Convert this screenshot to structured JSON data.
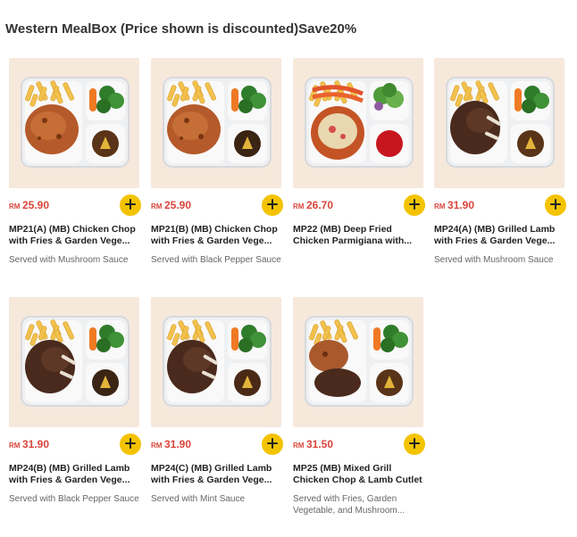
{
  "section": {
    "title": "Western MealBox (Price shown is discounted)Save20%"
  },
  "colors": {
    "accent": "#f4c300",
    "price": "#d9453b",
    "thumb_bg": "#f7e8dc"
  },
  "products": [
    {
      "currency": "RM",
      "price": "25.90",
      "name": "MP21(A) (MB) Chicken Chop with Fries & Garden Vege...",
      "desc": "Served with Mushroom Sauce",
      "meat": "chicken",
      "sauce": "mushroom"
    },
    {
      "currency": "RM",
      "price": "25.90",
      "name": "MP21(B) (MB) Chicken Chop with Fries & Garden Vege...",
      "desc": "Served with Black Pepper Sauce",
      "meat": "chicken",
      "sauce": "pepper"
    },
    {
      "currency": "RM",
      "price": "26.70",
      "name": "MP22 (MB) Deep Fried Chicken Parmigiana with...",
      "desc": "",
      "meat": "parmigiana",
      "sauce": "tomato"
    },
    {
      "currency": "RM",
      "price": "31.90",
      "name": "MP24(A) (MB) Grilled Lamb with Fries & Garden Vege...",
      "desc": "Served with Mushroom Sauce",
      "meat": "lamb",
      "sauce": "mushroom"
    },
    {
      "currency": "RM",
      "price": "31.90",
      "name": "MP24(B) (MB) Grilled Lamb with Fries & Garden Vege...",
      "desc": "Served with Black Pepper Sauce",
      "meat": "lamb",
      "sauce": "pepper"
    },
    {
      "currency": "RM",
      "price": "31.90",
      "name": "MP24(C) (MB) Grilled Lamb with Fries & Garden Vege...",
      "desc": "Served with Mint Sauce",
      "meat": "lamb",
      "sauce": "mint"
    },
    {
      "currency": "RM",
      "price": "31.50",
      "name": "MP25 (MB) Mixed Grill Chicken Chop & Lamb Cutlet",
      "desc": "Served with Fries, Garden Vegetable, and Mushroom...",
      "meat": "mixed",
      "sauce": "mushroom"
    }
  ]
}
